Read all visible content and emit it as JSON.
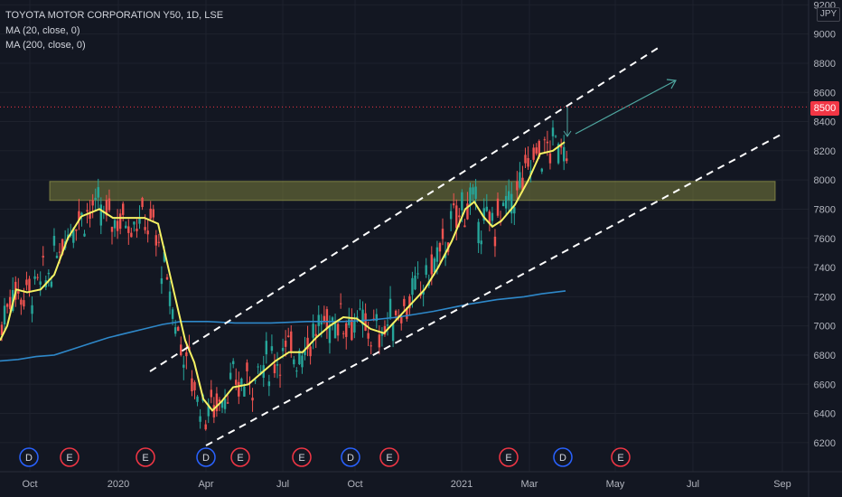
{
  "header": {
    "symbol": "TOYOTA MOTOR CORPORATION Y50, 1D, LSE",
    "ma20": "MA (20, close, 0)",
    "ma200": "MA (200, close, 0)"
  },
  "currency": "JPY",
  "last_price_label": "8500",
  "colors": {
    "background": "#131722",
    "up": "#26a69a",
    "down": "#ef5350",
    "ma20": "#f5f263",
    "ma200": "#2e88c9",
    "zone": "#7a7d3d",
    "channel": "#ffffff",
    "arrow": "#4fa7a0",
    "event_dividend": "#2962ff",
    "event_earnings": "#f23645"
  },
  "chart_data": {
    "type": "candlestick",
    "title": "TOYOTA MOTOR CORPORATION Y50, 1D, LSE",
    "ylim": [
      6000,
      9200
    ],
    "y_ticks": [
      6200,
      6400,
      6600,
      6800,
      7000,
      7200,
      7400,
      7600,
      7800,
      8000,
      8200,
      8400,
      8600,
      8800,
      9000,
      9200
    ],
    "x_ticks": [
      "Oct",
      "2020",
      "Apr",
      "Jul",
      "Oct",
      "2021",
      "Mar",
      "May",
      "Jul",
      "Sep"
    ],
    "last_price": 8500,
    "series": [
      {
        "name": "MA (20, close, 0)",
        "points": [
          [
            0,
            6900
          ],
          [
            8,
            7000
          ],
          [
            18,
            7250
          ],
          [
            30,
            7230
          ],
          [
            45,
            7250
          ],
          [
            60,
            7350
          ],
          [
            75,
            7600
          ],
          [
            90,
            7750
          ],
          [
            110,
            7800
          ],
          [
            125,
            7740
          ],
          [
            145,
            7740
          ],
          [
            160,
            7740
          ],
          [
            175,
            7700
          ],
          [
            190,
            7300
          ],
          [
            205,
            6900
          ],
          [
            215,
            6750
          ],
          [
            225,
            6500
          ],
          [
            235,
            6420
          ],
          [
            245,
            6480
          ],
          [
            258,
            6580
          ],
          [
            275,
            6600
          ],
          [
            290,
            6680
          ],
          [
            305,
            6760
          ],
          [
            320,
            6820
          ],
          [
            335,
            6820
          ],
          [
            350,
            6920
          ],
          [
            365,
            7000
          ],
          [
            380,
            7060
          ],
          [
            395,
            7050
          ],
          [
            410,
            6980
          ],
          [
            425,
            6950
          ],
          [
            440,
            7050
          ],
          [
            455,
            7150
          ],
          [
            470,
            7250
          ],
          [
            485,
            7400
          ],
          [
            500,
            7580
          ],
          [
            515,
            7800
          ],
          [
            525,
            7850
          ],
          [
            535,
            7750
          ],
          [
            545,
            7680
          ],
          [
            555,
            7720
          ],
          [
            570,
            7830
          ],
          [
            585,
            8000
          ],
          [
            598,
            8180
          ],
          [
            612,
            8200
          ],
          [
            625,
            8260
          ]
        ]
      },
      {
        "name": "MA (200, close, 0)",
        "points": [
          [
            0,
            6760
          ],
          [
            20,
            6770
          ],
          [
            40,
            6790
          ],
          [
            60,
            6800
          ],
          [
            80,
            6840
          ],
          [
            100,
            6880
          ],
          [
            120,
            6920
          ],
          [
            140,
            6950
          ],
          [
            160,
            6980
          ],
          [
            180,
            7010
          ],
          [
            200,
            7030
          ],
          [
            230,
            7030
          ],
          [
            260,
            7020
          ],
          [
            300,
            7020
          ],
          [
            340,
            7030
          ],
          [
            380,
            7030
          ],
          [
            410,
            7040
          ],
          [
            440,
            7060
          ],
          [
            480,
            7100
          ],
          [
            520,
            7150
          ],
          [
            550,
            7180
          ],
          [
            580,
            7200
          ],
          [
            600,
            7220
          ],
          [
            626,
            7240
          ]
        ]
      }
    ],
    "zones": [
      {
        "from": 7860,
        "to": 7990
      }
    ],
    "events": [
      {
        "label": "D",
        "kind": "dividend"
      },
      {
        "label": "E",
        "kind": "earnings"
      },
      {
        "label": "E",
        "kind": "earnings"
      },
      {
        "label": "D",
        "kind": "dividend"
      },
      {
        "label": "E",
        "kind": "earnings"
      },
      {
        "label": "E",
        "kind": "earnings"
      },
      {
        "label": "D",
        "kind": "dividend"
      },
      {
        "label": "E",
        "kind": "earnings"
      },
      {
        "label": "E",
        "kind": "earnings"
      },
      {
        "label": "D",
        "kind": "dividend"
      },
      {
        "label": "E",
        "kind": "earnings"
      }
    ],
    "grid": true
  }
}
